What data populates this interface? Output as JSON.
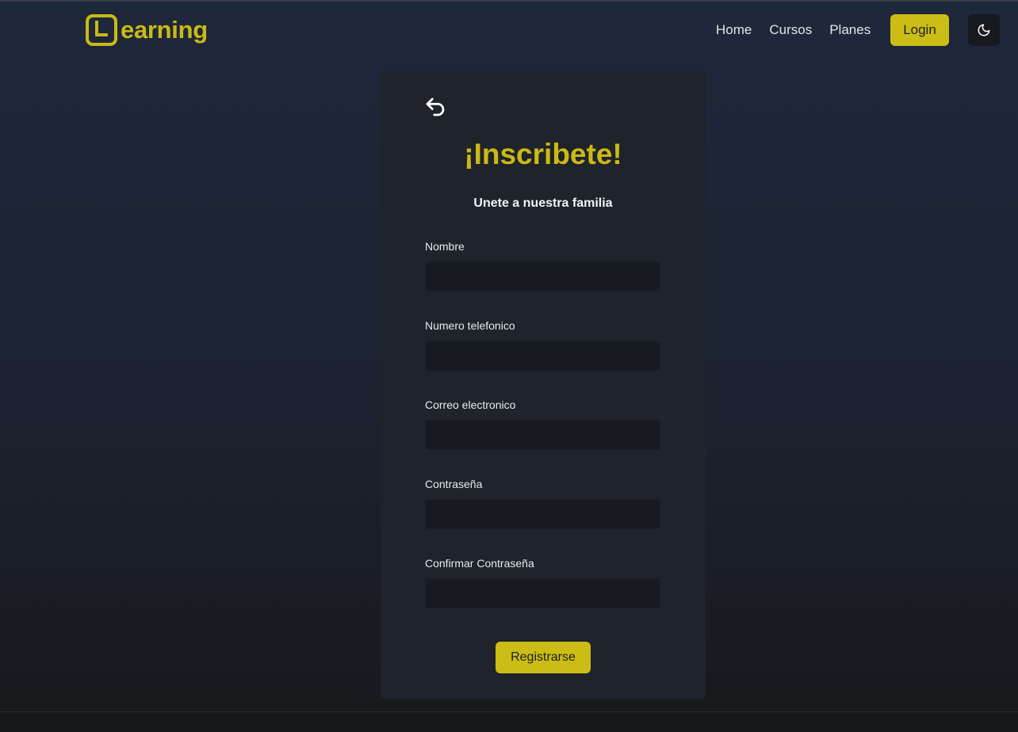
{
  "header": {
    "logo_text": "earning",
    "nav": [
      "Home",
      "Cursos",
      "Planes"
    ],
    "login_label": "Login",
    "theme_icon": "moon-icon"
  },
  "form": {
    "back_icon": "undo-arrow-icon",
    "title": "¡Inscribete!",
    "subtitle": "Unete a nuestra familia",
    "fields": [
      {
        "label": "Nombre",
        "value": ""
      },
      {
        "label": "Numero telefonico",
        "value": ""
      },
      {
        "label": "Correo electronico",
        "value": ""
      },
      {
        "label": "Contraseña",
        "value": ""
      },
      {
        "label": "Confirmar Contraseña",
        "value": ""
      }
    ],
    "submit_label": "Registrarse"
  },
  "colors": {
    "accent": "#cbbd16",
    "card": "#1f232b",
    "input": "#171a21"
  }
}
